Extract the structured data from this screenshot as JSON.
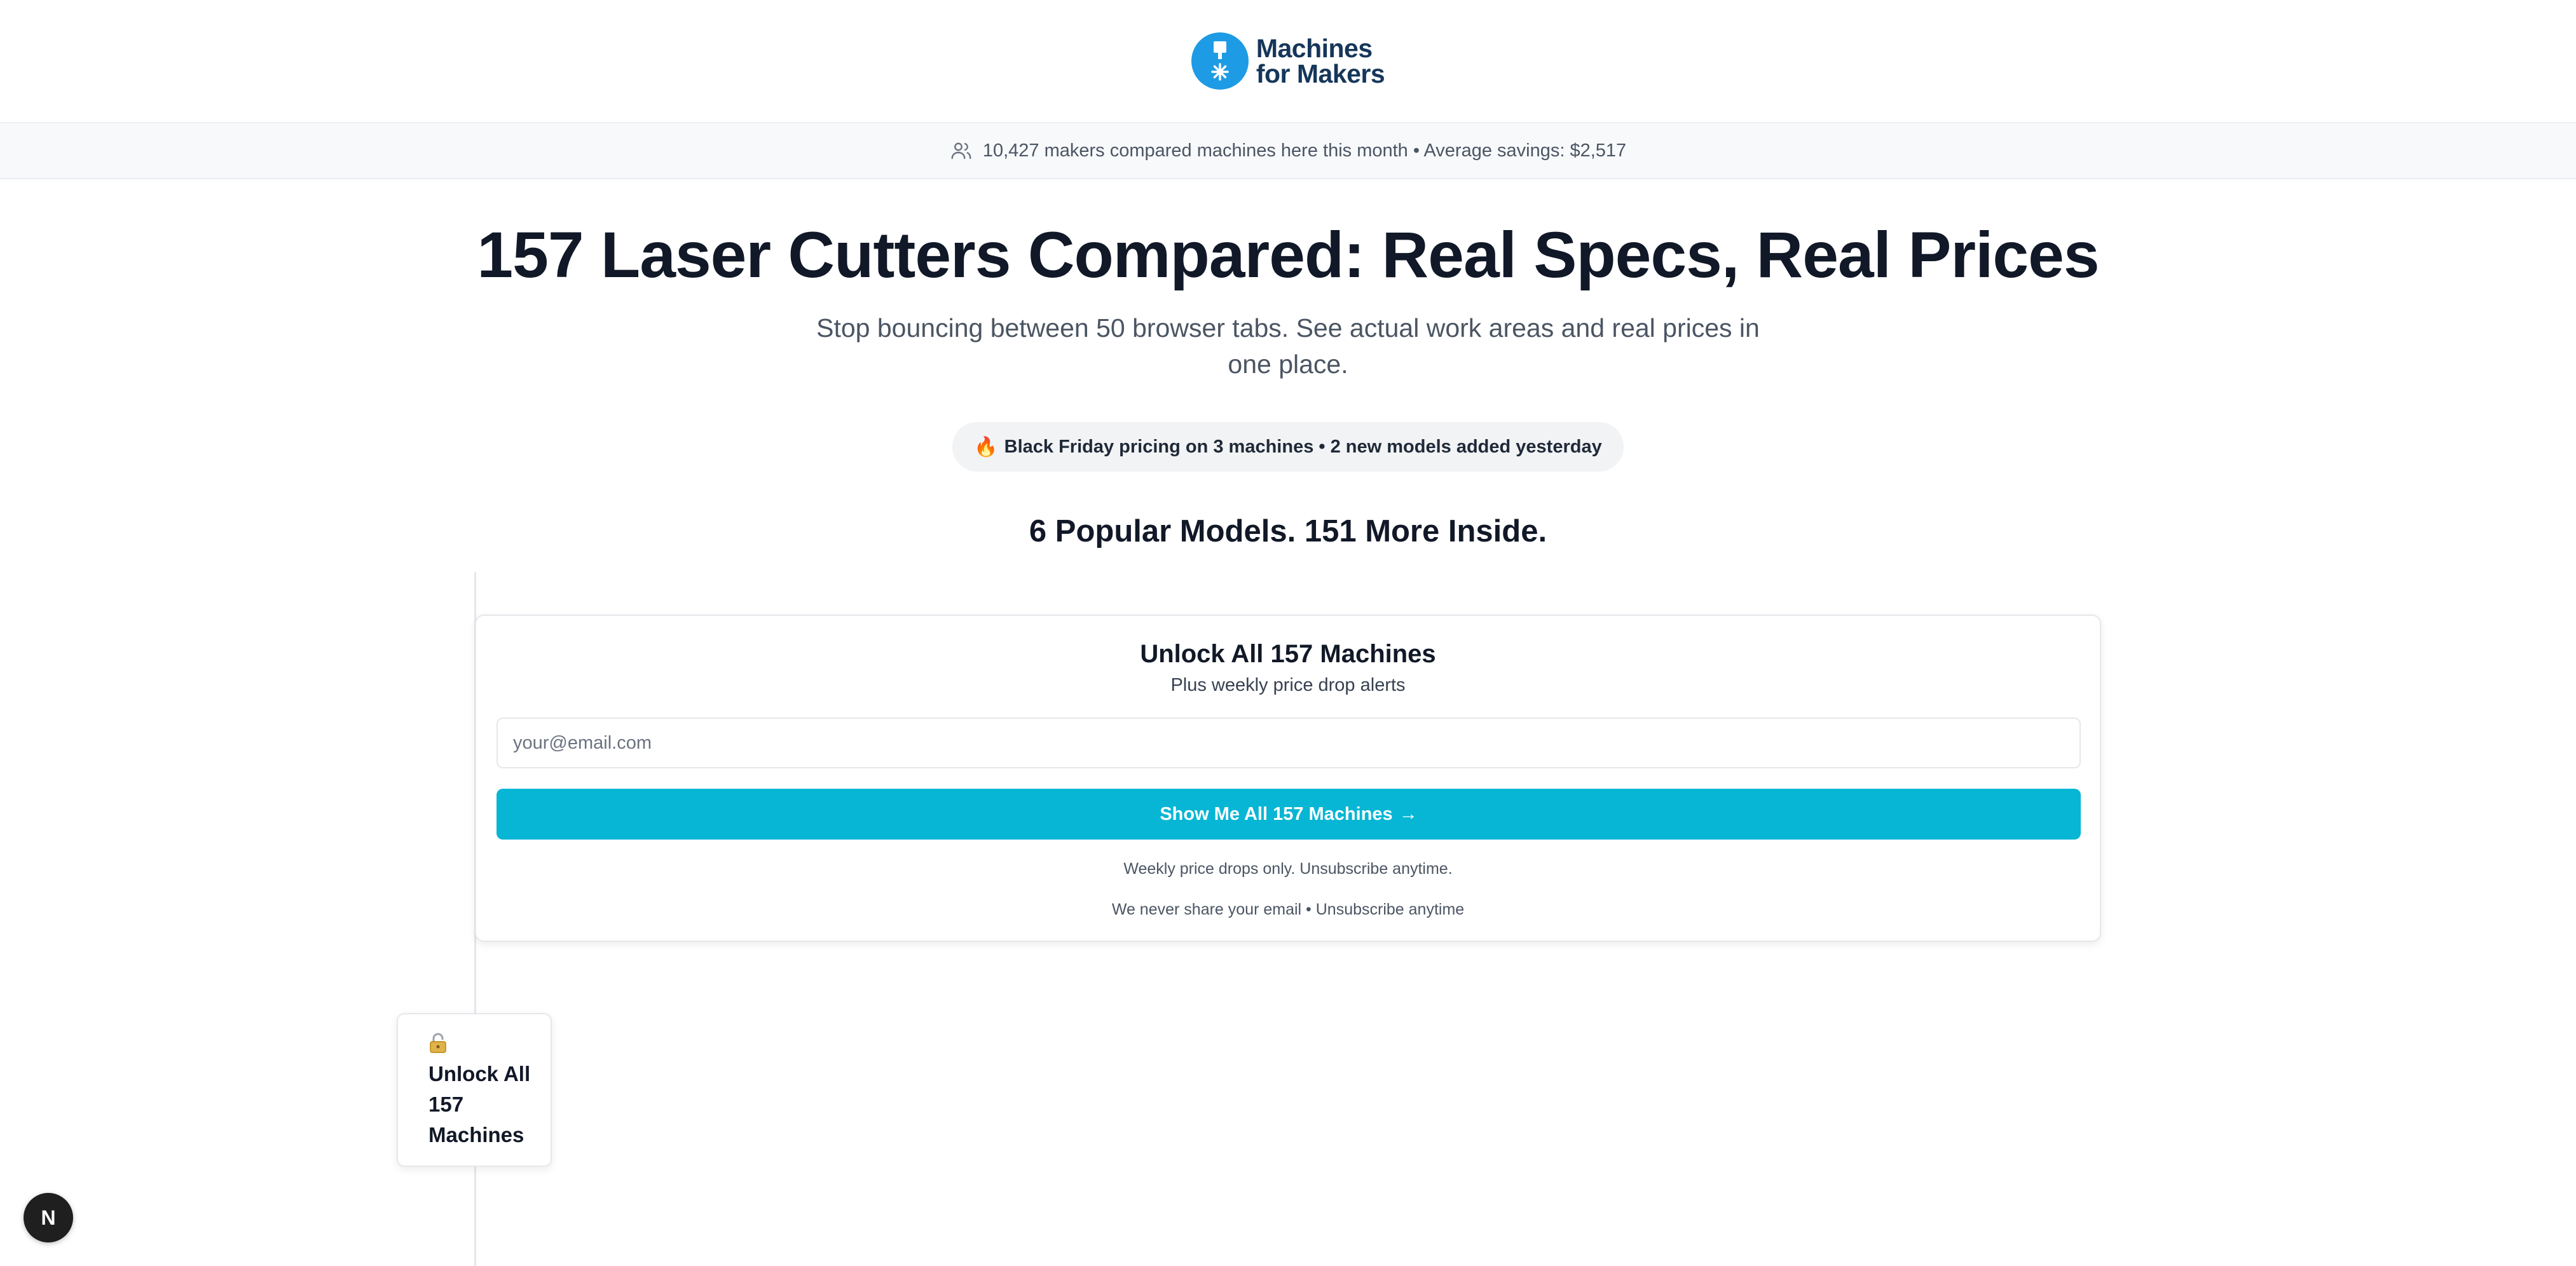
{
  "brand": {
    "line1": "Machines",
    "line2": "for Makers",
    "color": "#1e9be5"
  },
  "social_proof": {
    "icon": "users-icon",
    "text": "10,427 makers compared machines here this month • Average savings: $2,517"
  },
  "hero": {
    "title": "157 Laser Cutters Compared: Real Specs, Real Prices",
    "subtitle": "Stop bouncing between 50 browser tabs. See actual work areas and real prices in one place."
  },
  "promo": {
    "icon": "flame-icon",
    "emoji": "🔥",
    "text": "Black Friday pricing on 3 machines • 2 new models added yesterday"
  },
  "section": {
    "title": "6 Popular Models. 151 More Inside."
  },
  "signup_card": {
    "title": "Unlock All 157 Machines",
    "subtitle": "Plus weekly price drop alerts",
    "email_placeholder": "your@email.com",
    "email_value": "",
    "cta_label": "Show Me All 157 Machines",
    "cta_arrow": "→",
    "cta_color": "#06b6d4",
    "fine_print_1": "Weekly price drops only. Unsubscribe anytime.",
    "fine_print_2": "We never share your email • Unsubscribe anytime"
  },
  "floating_unlock": {
    "icon": "lock-icon",
    "label": "Unlock All 157 Machines"
  },
  "dev_badge": {
    "icon": "nextjs-icon",
    "letter": "N"
  }
}
